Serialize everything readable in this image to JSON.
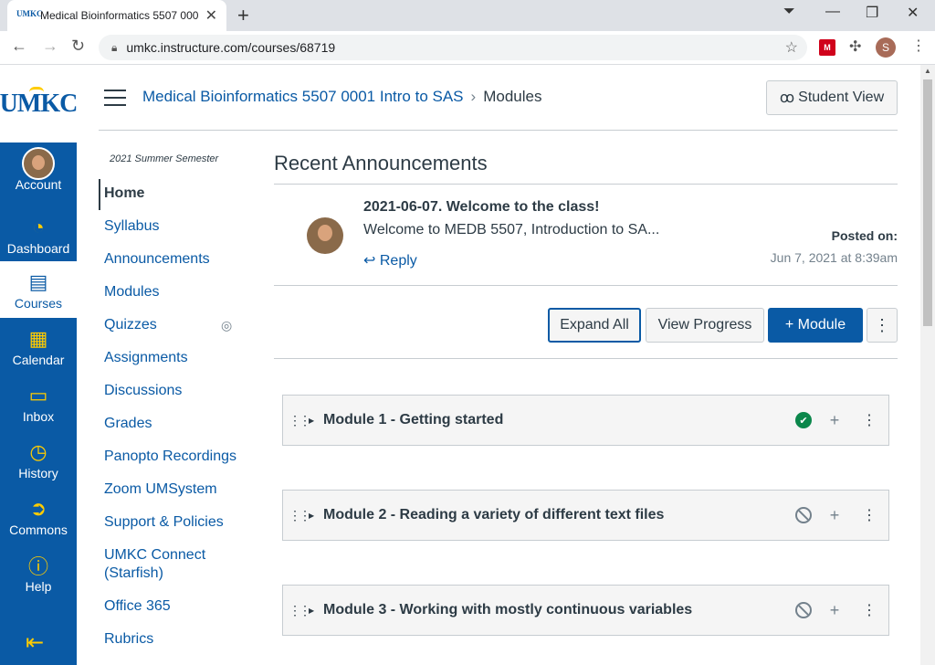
{
  "browser": {
    "tab_title": "Medical Bioinformatics 5507 000",
    "tab_favicon": "UMKC",
    "url": "umkc.instructure.com/courses/68719",
    "profile_initial": "S",
    "extension_label": "M"
  },
  "global_nav": {
    "logo": "UMKC",
    "items": [
      {
        "label": "Account",
        "icon": "avatar"
      },
      {
        "label": "Dashboard",
        "icon": "dashboard-icon"
      },
      {
        "label": "Courses",
        "icon": "book-icon"
      },
      {
        "label": "Calendar",
        "icon": "calendar-icon"
      },
      {
        "label": "Inbox",
        "icon": "inbox-icon"
      },
      {
        "label": "History",
        "icon": "clock-icon"
      },
      {
        "label": "Commons",
        "icon": "commons-icon"
      },
      {
        "label": "Help",
        "icon": "help-icon"
      }
    ],
    "collapse_glyph": "⇤"
  },
  "header": {
    "course_link": "Medical Bioinformatics 5507 0001 Intro to SAS",
    "separator": "›",
    "current": "Modules",
    "student_view": "Student View"
  },
  "course_nav": {
    "term": "2021 Summer Semester",
    "items": [
      "Home",
      "Syllabus",
      "Announcements",
      "Modules",
      "Quizzes",
      "Assignments",
      "Discussions",
      "Grades",
      "Panopto Recordings",
      "Zoom UMSystem",
      "Support & Policies",
      "UMKC Connect (Starfish)",
      "Office 365",
      "Rubrics"
    ]
  },
  "announcements": {
    "heading": "Recent Announcements",
    "title": "2021-06-07. Welcome to the class!",
    "body": "Welcome to MEDB 5507, Introduction to SA...",
    "reply": "Reply",
    "posted_label": "Posted on:",
    "posted_date": "Jun 7, 2021 at 8:39am"
  },
  "toolbar": {
    "expand_all": "Expand All",
    "view_progress": "View Progress",
    "add_module": "+ Module",
    "more": "⋮"
  },
  "modules": [
    {
      "name": "Module 1 - Getting started",
      "status": "completed"
    },
    {
      "name": "Module 2 - Reading a variety of different text files",
      "status": "not-started"
    },
    {
      "name": "Module 3 - Working with mostly continuous variables",
      "status": "not-started"
    }
  ],
  "colors": {
    "brand_blue": "#0a5aa5",
    "gold": "#ffcc00",
    "text": "#2d3b45",
    "success": "#0b874b"
  }
}
